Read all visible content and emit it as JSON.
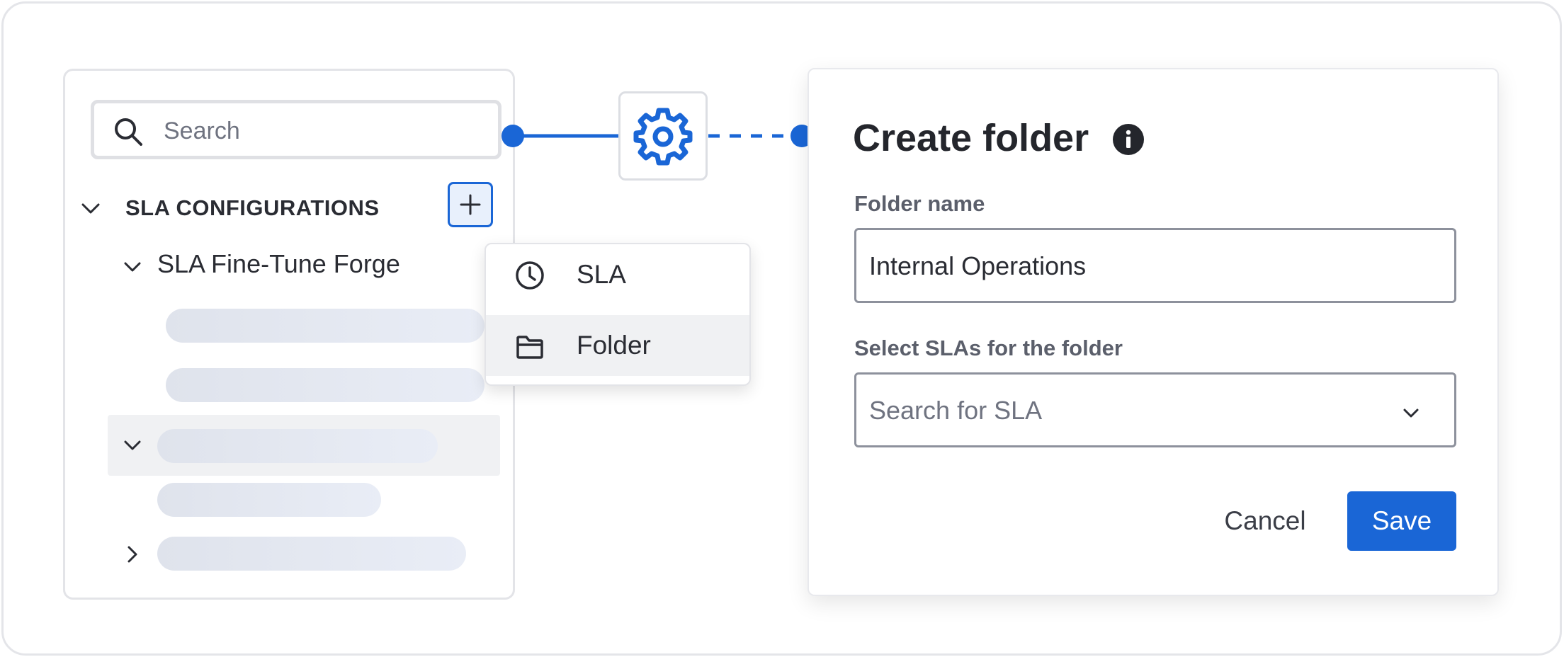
{
  "colors": {
    "accent": "#1a66d6",
    "skeleton": "#e3e7f0",
    "selected_row": "#f0f1f3",
    "text_primary": "#2a2c33"
  },
  "tree": {
    "search": {
      "placeholder": "Search",
      "icon": "search-icon"
    },
    "section_title": "SLA CONFIGURATIONS",
    "add_icon": "plus-icon",
    "folder": {
      "label": "SLA Fine-Tune Forge"
    }
  },
  "connector": {
    "icon": "gear-icon"
  },
  "menu": {
    "items": [
      {
        "label": "SLA",
        "icon": "clock-icon"
      },
      {
        "label": "Folder",
        "icon": "folder-icon"
      }
    ]
  },
  "dialog": {
    "title": "Create folder",
    "info_icon": "info-icon",
    "folder_name": {
      "label": "Folder name",
      "value": "Internal Operations"
    },
    "sla_select": {
      "label": "Select SLAs for the folder",
      "placeholder": "Search for SLA"
    },
    "cancel_label": "Cancel",
    "save_label": "Save"
  }
}
